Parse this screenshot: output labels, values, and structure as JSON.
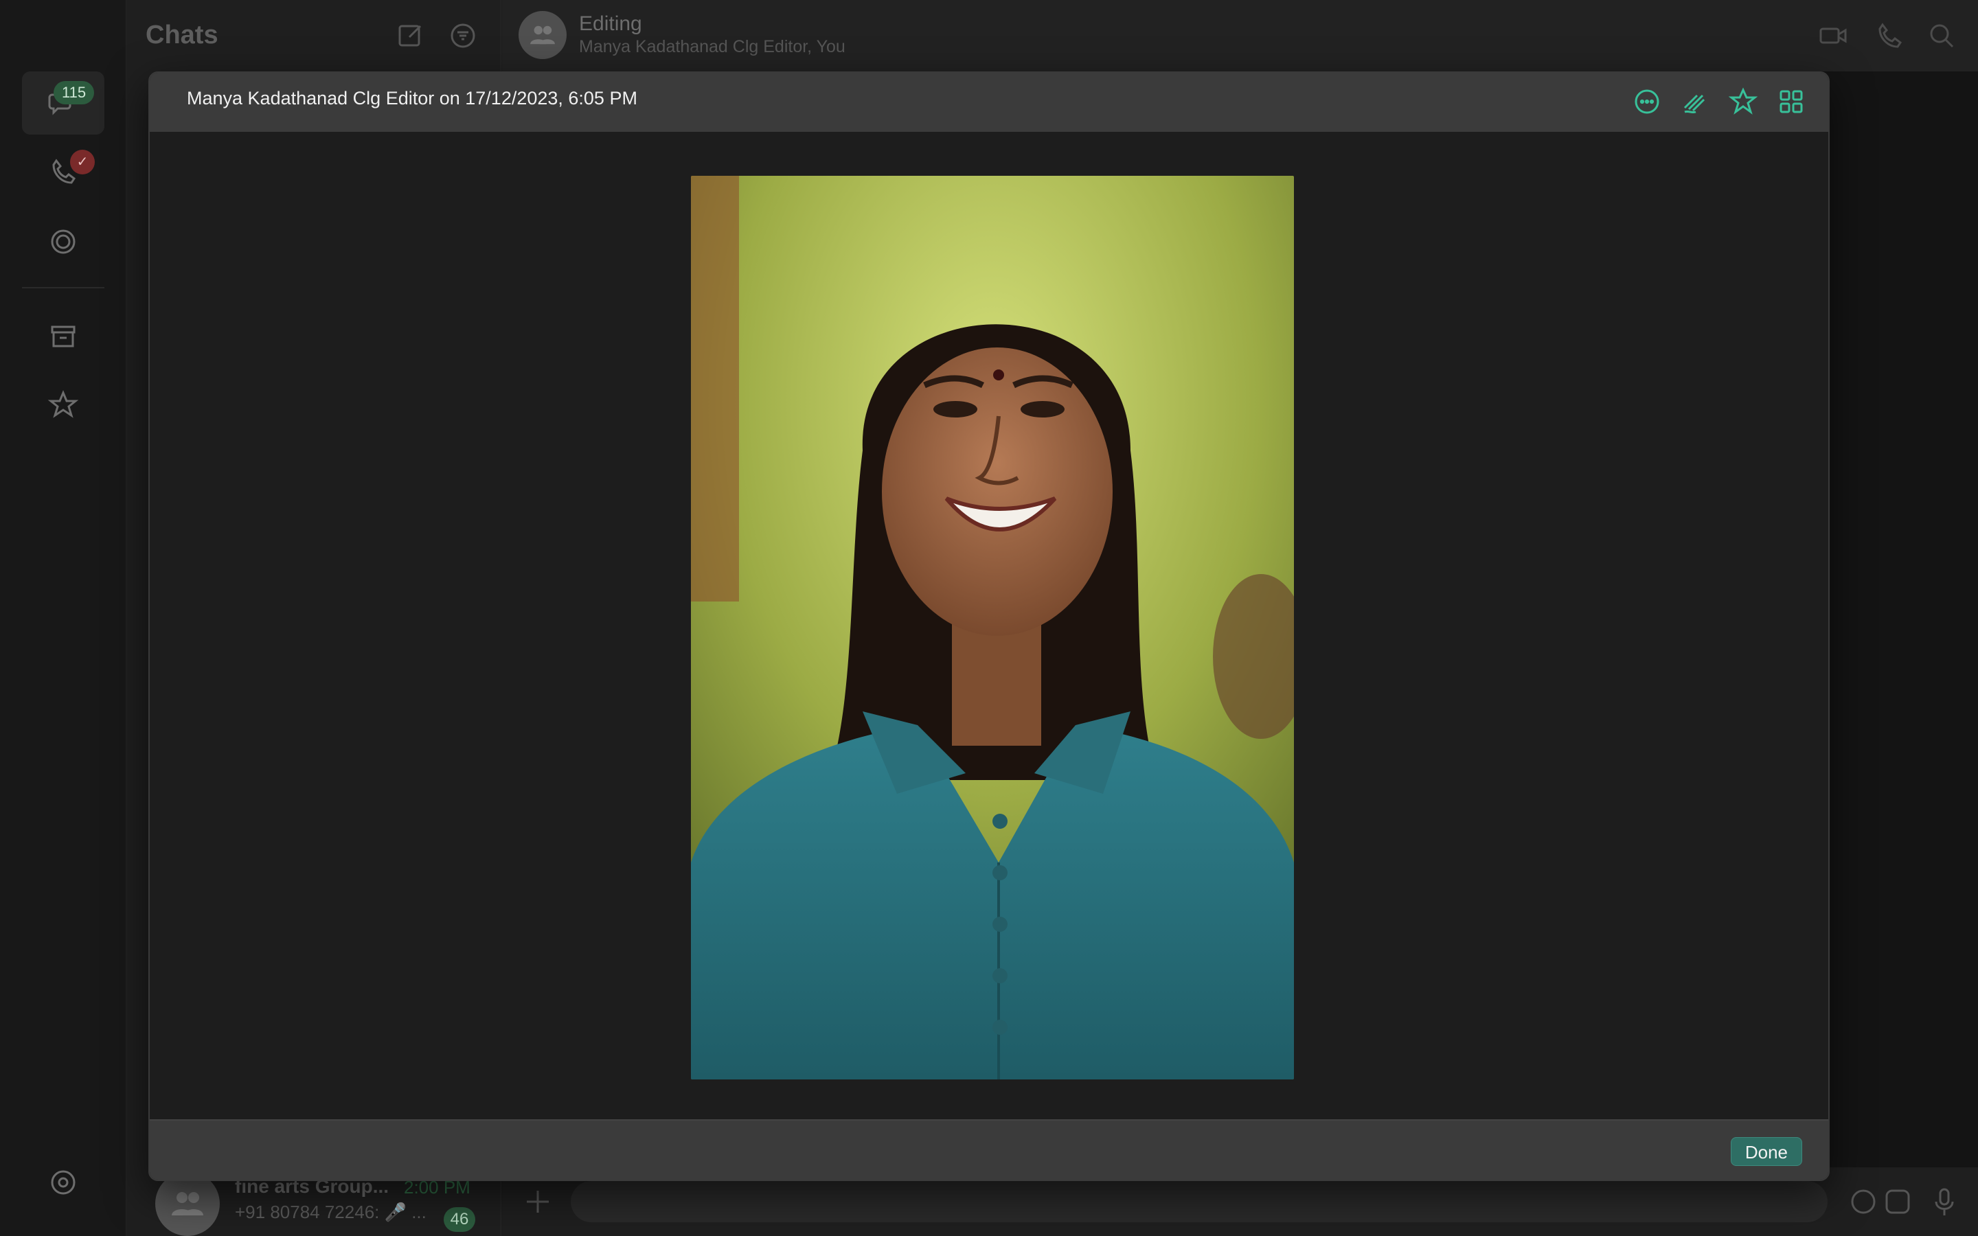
{
  "rail": {
    "chats_badge": "115",
    "calls_badge": "✓"
  },
  "chats_panel": {
    "title": "Chats",
    "preview_row": {
      "name": "fine arts Group...",
      "time": "2:00 PM",
      "preview": "+91 80784 72246: 🎤 ...",
      "unread": "46"
    }
  },
  "conversation": {
    "title": "Editing",
    "subtitle": "Manya Kadathanad Clg Editor, You"
  },
  "media_viewer": {
    "title": "Manya Kadathanad Clg Editor on 17/12/2023, 6:05 PM",
    "done_label": "Done",
    "photo_icon": "portrait-photo",
    "accent_color": "#38c19a"
  }
}
